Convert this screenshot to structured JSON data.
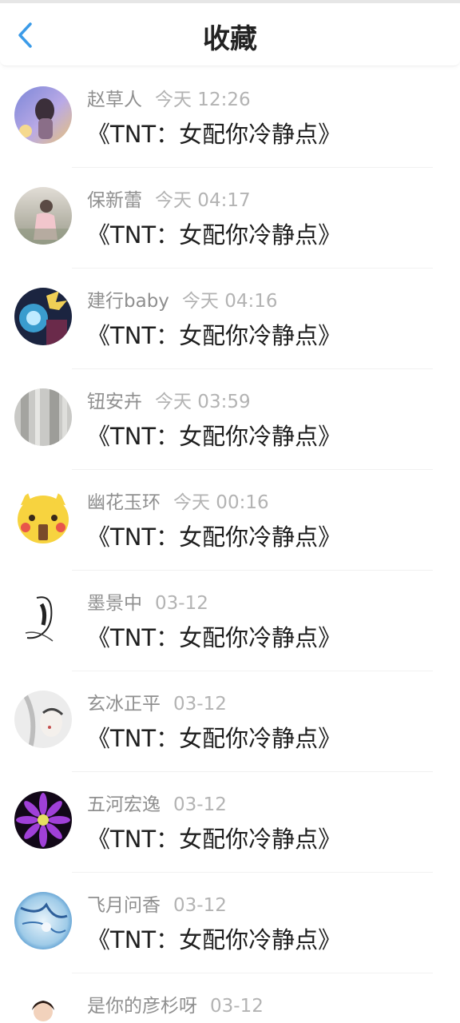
{
  "header": {
    "title": "收藏",
    "back_icon": "chevron-left-icon",
    "accent": "#3b9be8"
  },
  "items": [
    {
      "name": "赵草人",
      "time": "今天 12:26",
      "book": "《TNT：女配你冷静点》"
    },
    {
      "name": "保新蕾",
      "time": "今天 04:17",
      "book": "《TNT：女配你冷静点》"
    },
    {
      "name": "建行baby",
      "time": "今天 04:16",
      "book": "《TNT：女配你冷静点》"
    },
    {
      "name": "钮安卉",
      "time": "今天 03:59",
      "book": "《TNT：女配你冷静点》"
    },
    {
      "name": "幽花玉环",
      "time": "今天 00:16",
      "book": "《TNT：女配你冷静点》"
    },
    {
      "name": "墨景中",
      "time": "03-12",
      "book": "《TNT：女配你冷静点》"
    },
    {
      "name": "玄冰正平",
      "time": "03-12",
      "book": "《TNT：女配你冷静点》"
    },
    {
      "name": "五河宏逸",
      "time": "03-12",
      "book": "《TNT：女配你冷静点》"
    },
    {
      "name": "飞月问香",
      "time": "03-12",
      "book": "《TNT：女配你冷静点》"
    },
    {
      "name": "是你的彦杉呀",
      "time": "03-12",
      "book": ""
    }
  ]
}
